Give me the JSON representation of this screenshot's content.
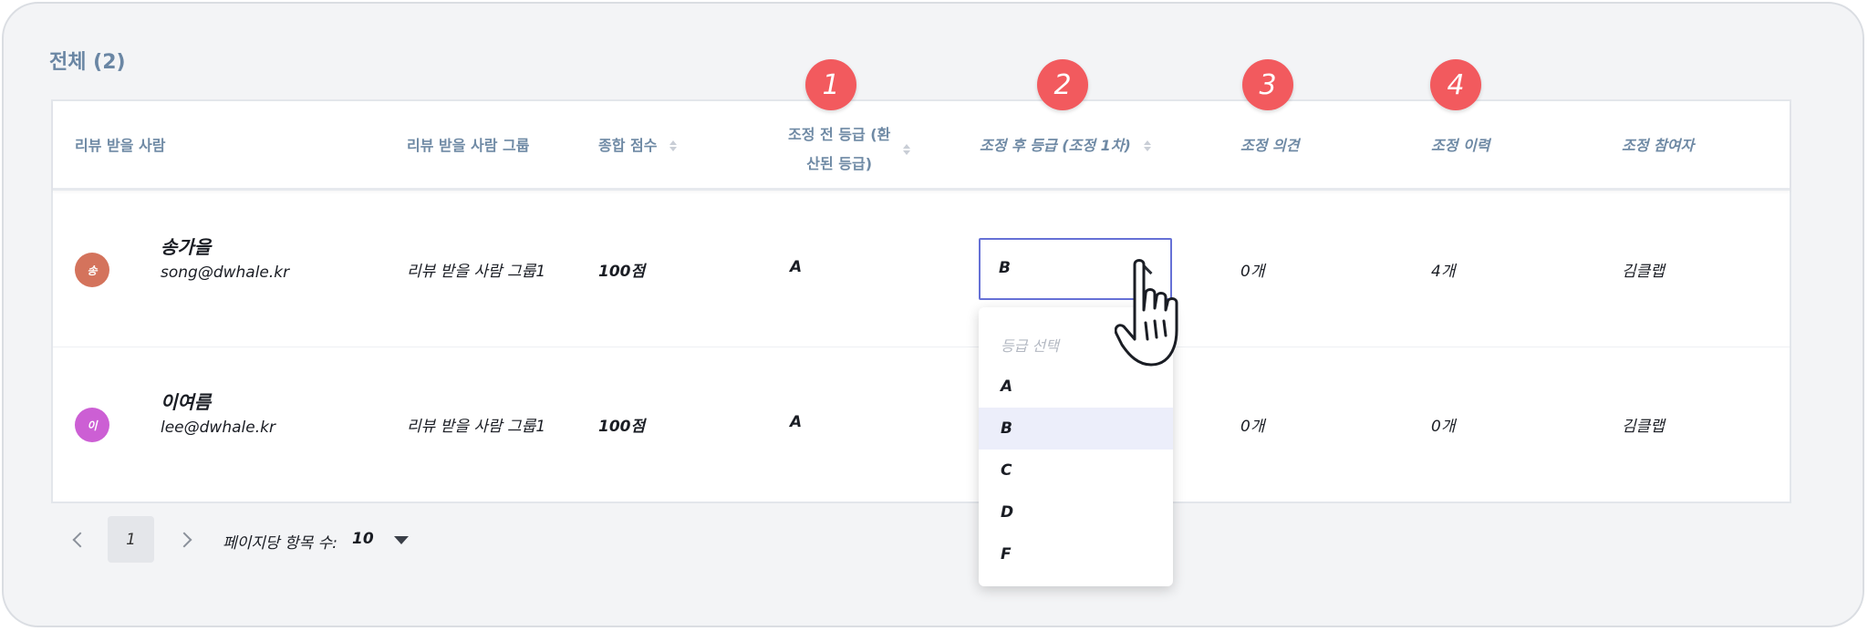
{
  "section_title": "전체 (2)",
  "columns": [
    "리뷰 받을 사람",
    "리뷰 받을 사람 그룹",
    "종합 점수",
    "조정 전 등급 (환",
    "산된 등급)",
    "조정 후 등급 (조정 1차)",
    "조정 의견",
    "조정 이력",
    "조정 참여자"
  ],
  "badges": [
    "1",
    "2",
    "3",
    "4"
  ],
  "rows": [
    {
      "avatar_initial": "송",
      "avatar_color": "#d4735c",
      "name": "송가을",
      "email": "song@dwhale.kr",
      "group": "리뷰 받을 사람 그룹1",
      "score": "100점",
      "grade_before": "A",
      "grade_after": "B",
      "opinions": "0개",
      "history": "4개",
      "participants": "김클랩"
    },
    {
      "avatar_initial": "이",
      "avatar_color": "#cc5fd4",
      "name": "이여름",
      "email": "lee@dwhale.kr",
      "group": "리뷰 받을 사람 그룹1",
      "score": "100점",
      "grade_before": "A",
      "opinions": "0개",
      "history": "0개",
      "participants": "김클랩"
    }
  ],
  "grade_dropdown": {
    "placeholder": "등급 선택",
    "options": [
      "A",
      "B",
      "C",
      "D",
      "F"
    ],
    "selected": "B"
  },
  "pagination": {
    "current_page": "1",
    "per_page_label": "페이지당 항목 수:",
    "per_page_value": "10"
  },
  "colors": {
    "accent": "#6671d6",
    "badge": "#f25a5e",
    "header_text": "#6f8aa5"
  }
}
